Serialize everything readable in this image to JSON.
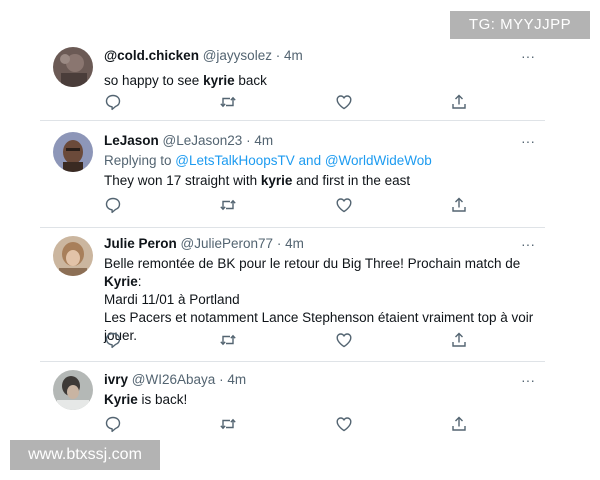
{
  "tweets": [
    {
      "display_name": "@cold.chicken",
      "handle": "@jayysolez",
      "sep": "·",
      "time": "4m",
      "reply_prefix": "",
      "reply_targets": "",
      "text_parts": [
        "so happy to see ",
        "kyrie",
        " back"
      ],
      "avatar": "avatar-cold-chicken"
    },
    {
      "display_name": "LeJason",
      "handle": "@LeJason23",
      "sep": "·",
      "time": "4m",
      "reply_prefix": "Replying to ",
      "reply_targets": "@LetsTalkHoopsTV and @WorldWideWob",
      "text_parts": [
        "They won 17 straight with ",
        "kyrie",
        " and first in the east"
      ],
      "avatar": "avatar-lejason"
    },
    {
      "display_name": "Julie Peron",
      "handle": "@JuliePeron77",
      "sep": "·",
      "time": "4m",
      "reply_prefix": "",
      "reply_targets": "",
      "text_parts": [
        "Belle remontée de BK pour le retour du Big Three! Prochain match de ",
        "Kyrie",
        ":"
      ],
      "text_line2": "Mardi 11/01 à Portland",
      "text_line3": "Les Pacers et notamment Lance Stephenson étaient vraiment top à voir jouer.",
      "avatar": "avatar-julie"
    },
    {
      "display_name": "ivry",
      "handle": "@WI26Abaya",
      "sep": "·",
      "time": "4m",
      "reply_prefix": "",
      "reply_targets": "",
      "text_parts": [
        "Kyrie",
        " is back!"
      ],
      "avatar": "avatar-ivry"
    }
  ],
  "actions": [
    "reply-icon",
    "retweet-icon",
    "like-icon",
    "share-icon"
  ],
  "more_label": "···",
  "watermark_tg": "TG: MYYJJPP",
  "watermark_url": "www.btxssj.com",
  "colors": {
    "text": "#0f1419",
    "meta": "#536471",
    "link": "#1d9bf0",
    "divider": "#dfe3e7"
  }
}
